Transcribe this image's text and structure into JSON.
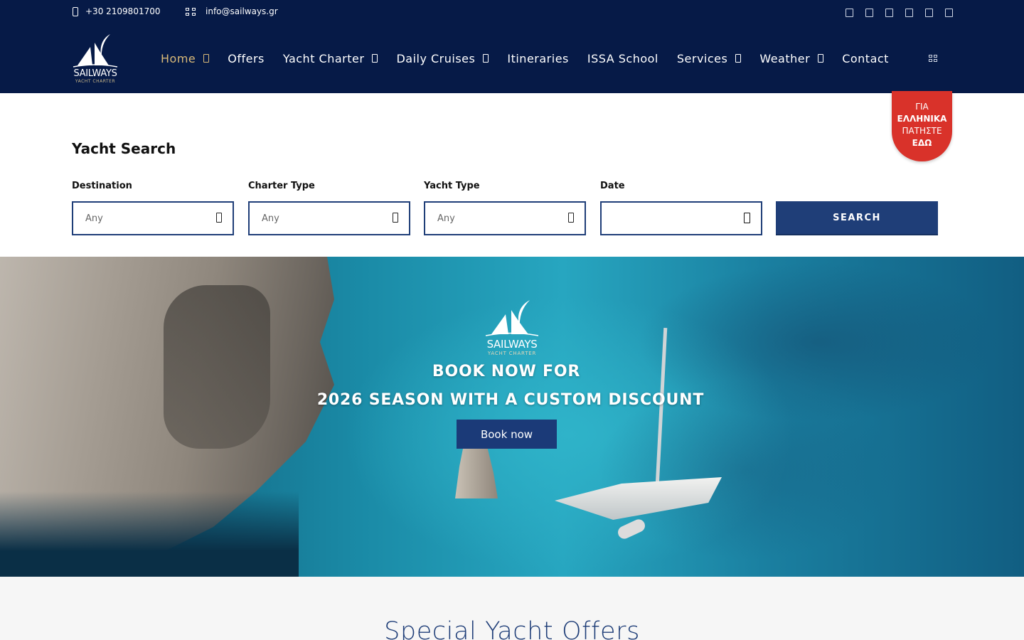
{
  "topbar": {
    "phone": "+30 2109801700",
    "email": "info@sailways.gr",
    "social_icons": [
      "facebook-icon",
      "instagram-icon",
      "twitter-icon",
      "youtube-icon",
      "linkedin-icon",
      "tripadvisor-icon"
    ]
  },
  "logo": {
    "name": "SAILWAYS",
    "tagline": "YACHT CHARTER"
  },
  "nav": {
    "items": [
      {
        "label": "Home",
        "dropdown": true,
        "active": true
      },
      {
        "label": "Offers",
        "dropdown": false
      },
      {
        "label": "Yacht Charter",
        "dropdown": true
      },
      {
        "label": "Daily Cruises",
        "dropdown": true
      },
      {
        "label": "Itineraries",
        "dropdown": false
      },
      {
        "label": "ISSA School",
        "dropdown": false
      },
      {
        "label": "Services",
        "dropdown": true
      },
      {
        "label": "Weather",
        "dropdown": true
      },
      {
        "label": "Contact",
        "dropdown": false
      }
    ]
  },
  "greek_badge": {
    "line1": "ΓΙΑ",
    "line2": "ΕΛΛΗΝΙΚΑ",
    "line3": "ΠΑΤΗΣΤΕ",
    "line4": "ΕΔΩ"
  },
  "search": {
    "title": "Yacht Search",
    "destination": {
      "label": "Destination",
      "value": "Any"
    },
    "charter_type": {
      "label": "Charter Type",
      "value": "Any"
    },
    "yacht_type": {
      "label": "Yacht Type",
      "value": "Any"
    },
    "date": {
      "label": "Date",
      "value": ""
    },
    "button": "SEARCH"
  },
  "hero": {
    "logo_name": "SAILWAYS",
    "logo_tagline": "YACHT CHARTER",
    "line1": "BOOK NOW FOR",
    "line2": "2026 SEASON WITH A CUSTOM DISCOUNT",
    "button": "Book now"
  },
  "offers": {
    "title": "Special Yacht Offers"
  },
  "colors": {
    "navy": "#061a47",
    "button_blue": "#1f3e78",
    "accent_gold": "#d9b978",
    "badge_red": "#d9322a"
  }
}
